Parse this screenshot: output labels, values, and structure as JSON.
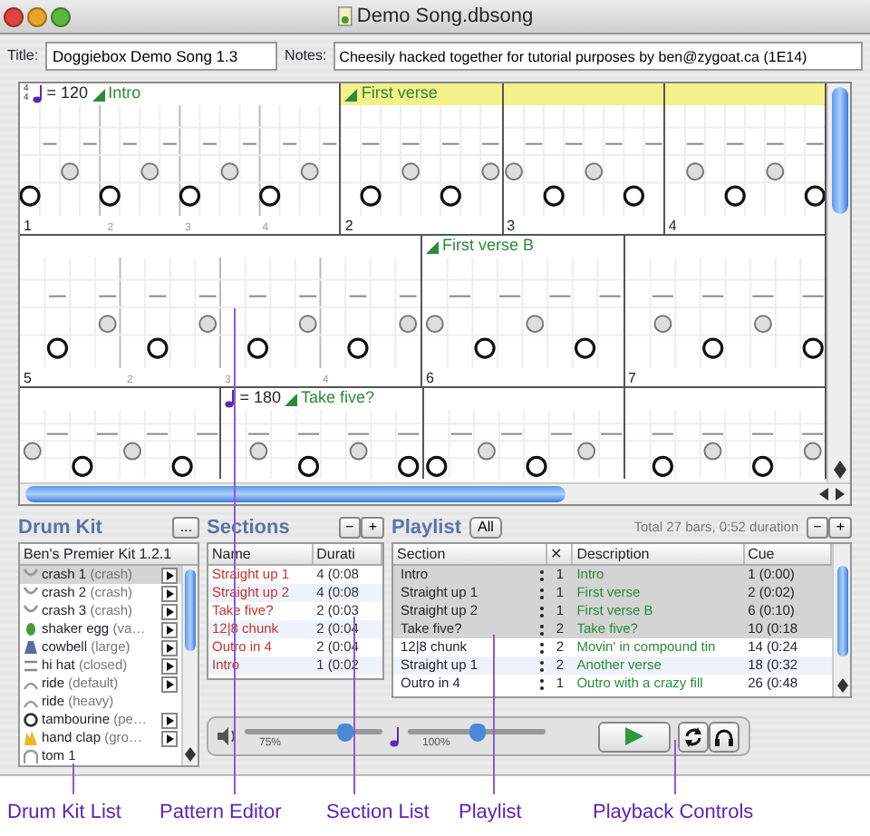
{
  "window": {
    "title": "Demo Song.dbsong"
  },
  "song": {
    "title_label": "Title:",
    "title": "Doggiebox Demo Song 1.3",
    "notes_label": "Notes:",
    "notes": "Cheesily hacked together for tutorial purposes by ben@zygoat.ca (1E14)"
  },
  "pattern_editor": {
    "rows": [
      {
        "bars": [
          {
            "number": "1",
            "beats": [
              "2",
              "3",
              "4"
            ],
            "highlighted": false,
            "header": {
              "time_signature": [
                "4",
                "4"
              ],
              "tempo": "= 120",
              "label": "Intro"
            }
          },
          {
            "number": "2",
            "highlighted": true,
            "header": {
              "label": "First verse"
            }
          },
          {
            "number": "3",
            "highlighted": true
          },
          {
            "number": "4",
            "highlighted": true
          }
        ]
      },
      {
        "bars": [
          {
            "number": "5",
            "beats": [
              "2",
              "3",
              "4"
            ],
            "highlighted": false
          },
          {
            "number": "6",
            "highlighted": false,
            "header": {
              "label": "First verse B"
            }
          },
          {
            "number": "7",
            "highlighted": false
          }
        ]
      },
      {
        "bars": [
          {
            "highlighted": false
          },
          {
            "highlighted": false,
            "header": {
              "tempo": "= 180",
              "label": "Take five?"
            }
          },
          {
            "highlighted": false
          },
          {
            "highlighted": false
          }
        ]
      }
    ]
  },
  "drum_kit": {
    "title": "Drum Kit",
    "menu_button": "...",
    "kit_name": "Ben's Premier Kit 1.2.1",
    "items": [
      {
        "kind": "cymbal",
        "name": "crash 1",
        "detail": "(crash)",
        "selected": true,
        "playable": true
      },
      {
        "kind": "cymbal",
        "name": "crash 2",
        "detail": "(crash)",
        "selected": false,
        "playable": true
      },
      {
        "kind": "cymbal",
        "name": "crash 3",
        "detail": "(crash)",
        "selected": false,
        "playable": true
      },
      {
        "kind": "shaker",
        "name": "shaker egg",
        "detail": "(va…",
        "selected": false,
        "playable": true
      },
      {
        "kind": "cowbell",
        "name": "cowbell",
        "detail": "(large)",
        "selected": false,
        "playable": true
      },
      {
        "kind": "hihat",
        "name": "hi hat",
        "detail": "(closed)",
        "selected": false,
        "playable": true
      },
      {
        "kind": "ride",
        "name": "ride",
        "detail": "(default)",
        "selected": false,
        "playable": true
      },
      {
        "kind": "ride",
        "name": "ride",
        "detail": "(heavy)",
        "selected": false,
        "playable": false
      },
      {
        "kind": "tambourine",
        "name": "tambourine",
        "detail": "(pe…",
        "selected": false,
        "playable": true
      },
      {
        "kind": "clap",
        "name": "hand clap",
        "detail": "(gro…",
        "selected": false,
        "playable": true
      },
      {
        "kind": "tom",
        "name": "tom 1",
        "selected": false,
        "playable": false
      }
    ]
  },
  "sections": {
    "title": "Sections",
    "buttons": [
      "−",
      "+"
    ],
    "columns": [
      "Name",
      "Durati"
    ],
    "rows": [
      {
        "name": "Straight up 1",
        "duration": "4 (0:08"
      },
      {
        "name": "Straight up 2",
        "duration": "4 (0:08"
      },
      {
        "name": "Take five?",
        "duration": "2 (0:03"
      },
      {
        "name": "12|8 chunk",
        "duration": "2 (0:04"
      },
      {
        "name": "Outro in 4",
        "duration": "2 (0:04"
      },
      {
        "name": "Intro",
        "duration": "1 (0:02"
      }
    ]
  },
  "playlist": {
    "title": "Playlist",
    "filter_button": "All",
    "summary": "Total 27 bars, 0:52 duration",
    "buttons": [
      "−",
      "+"
    ],
    "columns": [
      "Section",
      "✕",
      "Description",
      "Cue"
    ],
    "rows": [
      {
        "section": "Intro",
        "count": "1",
        "description": "Intro",
        "cue": "1 (0:00)",
        "selected": true
      },
      {
        "section": "Straight up 1",
        "count": "1",
        "description": "First verse",
        "cue": "2 (0:02)",
        "selected": true
      },
      {
        "section": "Straight up 2",
        "count": "1",
        "description": "First verse B",
        "cue": "6 (0:10)",
        "selected": true
      },
      {
        "section": "Take five?",
        "count": "2",
        "description": "Take five?",
        "cue": "10 (0:18",
        "selected": true
      },
      {
        "section": "12|8 chunk",
        "count": "2",
        "description": "Movin' in compound tin",
        "cue": "14 (0:24",
        "selected": false
      },
      {
        "section": "Straight up 1",
        "count": "2",
        "description": "Another verse",
        "cue": "18 (0:32",
        "selected": false
      },
      {
        "section": "Outro in 4",
        "count": "1",
        "description": "Outro with a crazy fill",
        "cue": "26 (0:48",
        "selected": false
      }
    ]
  },
  "playback": {
    "volume": {
      "level": 0.73,
      "label": "75%"
    },
    "tempo": {
      "level": 0.5,
      "label": "100%"
    }
  },
  "annotations": [
    "Drum Kit List",
    "Pattern Editor",
    "Section List",
    "Playlist",
    "Playback Controls"
  ]
}
